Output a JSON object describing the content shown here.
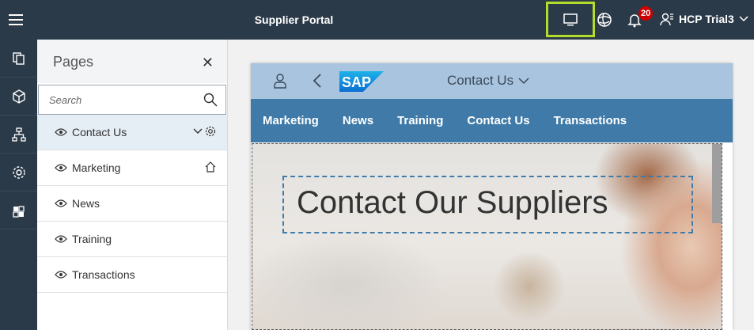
{
  "topbar": {
    "title": "Supplier Portal",
    "notification_count": "20",
    "user_name": "HCP Trial3",
    "highlight_color": "#b4dc2a"
  },
  "pages_panel": {
    "title": "Pages",
    "close_icon": "close-icon",
    "search_placeholder": "Search",
    "items": [
      {
        "label": "Contact Us",
        "selected": true
      },
      {
        "label": "Marketing"
      },
      {
        "label": "News"
      },
      {
        "label": "Training"
      },
      {
        "label": "Transactions"
      }
    ]
  },
  "site": {
    "title": "Contact Us",
    "logo_text": "SAP",
    "nav": [
      "Marketing",
      "News",
      "Training",
      "Contact Us",
      "Transactions"
    ],
    "hero_title": "Contact Our Suppliers"
  }
}
